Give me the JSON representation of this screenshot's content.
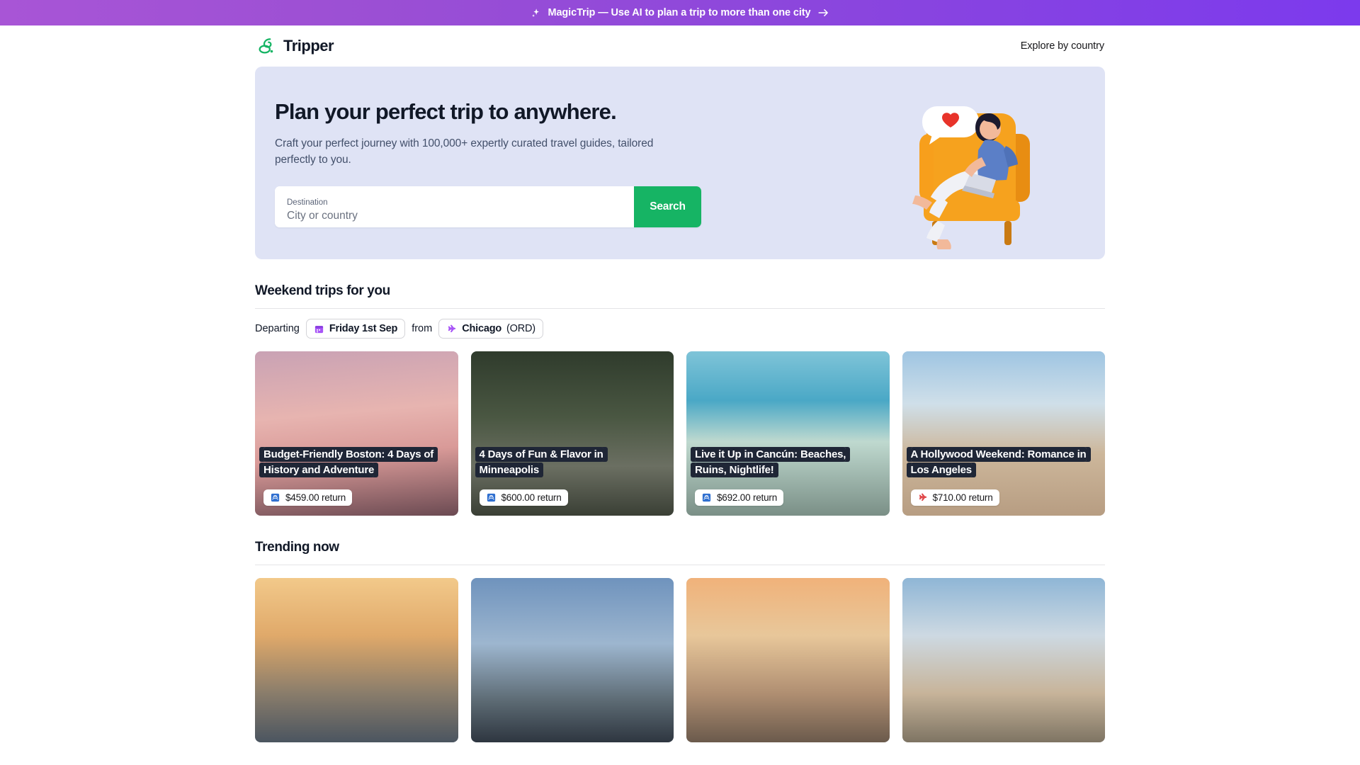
{
  "promo": {
    "text": "MagicTrip — Use AI to plan a trip to more than one city",
    "spark_icon": "sparkle-icon",
    "arrow_icon": "arrow-right-icon",
    "gradient_from": "#a855d6",
    "gradient_to": "#7c3aed"
  },
  "header": {
    "logo_icon": "tripper-loop-logo-icon",
    "brand": "Tripper",
    "brand_color": "#16b464",
    "nav_link": "Explore by country"
  },
  "hero": {
    "title": "Plan your perfect trip to anywhere.",
    "subtitle": "Craft your perfect journey with 100,000+ expertly curated travel guides, tailored perfectly to you.",
    "background": "#dfe3f5",
    "search": {
      "label": "Destination",
      "placeholder": "City or country",
      "value": "",
      "button_label": "Search",
      "button_color": "#16b464"
    },
    "illustration": "woman-in-armchair-with-heart-chat-illustration"
  },
  "weekend": {
    "title": "Weekend trips for you",
    "departing_label": "Departing",
    "from_label": "from",
    "date_chip": {
      "icon": "calendar-icon",
      "label": "Friday 1st Sep"
    },
    "origin_chip": {
      "icon": "airplane-icon",
      "city": "Chicago",
      "code": "(ORD)"
    },
    "cards": [
      {
        "title": "Budget-Friendly Boston: 4 Days of History and Adventure",
        "price": "$459.00 return",
        "price_icon": "train-icon",
        "photo": "ph-boston"
      },
      {
        "title": "4 Days of Fun & Flavor in Minneapolis",
        "price": "$600.00 return",
        "price_icon": "train-icon",
        "photo": "ph-minn"
      },
      {
        "title": "Live it Up in Cancún: Beaches, Ruins, Nightlife!",
        "price": "$692.00 return",
        "price_icon": "train-icon",
        "photo": "ph-cancun"
      },
      {
        "title": "A Hollywood Weekend: Romance in Los Angeles",
        "price": "$710.00 return",
        "price_icon": "airplane-icon",
        "photo": "ph-la"
      }
    ]
  },
  "trending": {
    "title": "Trending now",
    "cards": [
      {
        "photo": "ph-porto"
      },
      {
        "photo": "ph-vienna"
      },
      {
        "photo": "ph-madrid"
      },
      {
        "photo": "ph-brighton"
      }
    ]
  }
}
